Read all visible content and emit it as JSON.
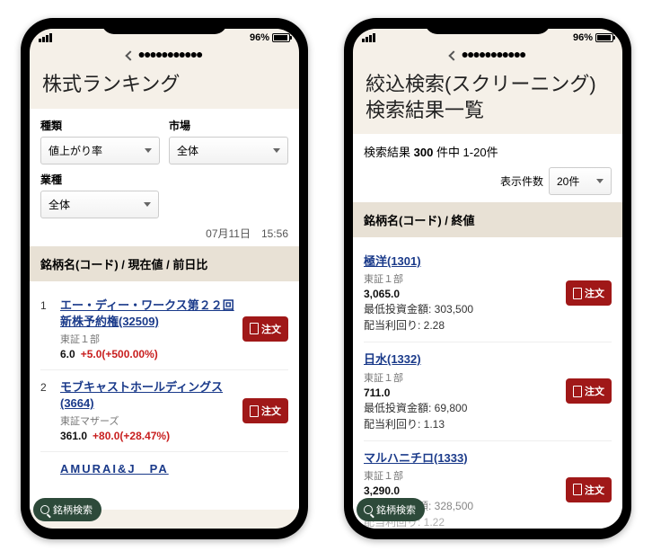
{
  "status": {
    "battery": "96%",
    "carrier_dots": "●●●●●●●●●●●"
  },
  "left": {
    "title": "株式ランキング",
    "filters": {
      "type_label": "種類",
      "type_value": "値上がり率",
      "market_label": "市場",
      "market_value": "全体",
      "industry_label": "業種",
      "industry_value": "全体"
    },
    "timestamp": "07月11日　15:56",
    "header": "銘柄名(コード) / 現在値 / 前日比",
    "order_label": "注文",
    "rows": [
      {
        "n": "1",
        "name": "エー・ディー・ワークス第２２回新株予約権(32509)",
        "market": "東証１部",
        "price": "6.0",
        "change": "+5.0(+500.00%)"
      },
      {
        "n": "2",
        "name": "モブキャストホールディングス(3664)",
        "market": "東証マザーズ",
        "price": "361.0",
        "change": "+80.0(+28.47%)"
      }
    ],
    "overflow_name": "AMURAI&J　PA",
    "search_label": "銘柄検索"
  },
  "right": {
    "title": "絞込検索(スクリーニング)検索結果一覧",
    "summary_prefix": "検索結果 ",
    "summary_count": "300",
    "summary_suffix": " 件中 1-20件",
    "display_label": "表示件数",
    "display_value": "20件",
    "header": "銘柄名(コード) / 終値",
    "order_label": "注文",
    "min_invest_label": "最低投資金額: ",
    "yield_label": "配当利回り: ",
    "rows": [
      {
        "name": "極洋(1301)",
        "market": "東証１部",
        "price": "3,065.0",
        "min_invest": "303,500",
        "yield": "2.28"
      },
      {
        "name": "日水(1332)",
        "market": "東証１部",
        "price": "711.0",
        "min_invest": "69,800",
        "yield": "1.13"
      },
      {
        "name": "マルハニチロ(1333)",
        "market": "東証１部",
        "price": "3,290.0",
        "min_invest": "328,500",
        "yield": "1.22"
      }
    ],
    "search_label": "銘柄検索"
  }
}
